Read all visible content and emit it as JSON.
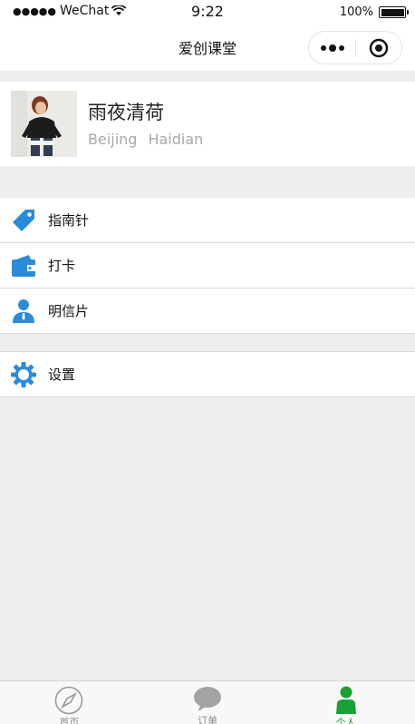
{
  "status_bar": {
    "carrier": "WeChat",
    "time": "9:22",
    "battery": "100%"
  },
  "nav": {
    "title": "爱创课堂"
  },
  "profile": {
    "name": "雨夜清荷",
    "city": "Beijing",
    "district": "Haidian"
  },
  "menu_group1": [
    {
      "label": "指南针",
      "icon": "tag-icon"
    },
    {
      "label": "打卡",
      "icon": "wallet-icon"
    },
    {
      "label": "明信片",
      "icon": "person-icon"
    }
  ],
  "menu_group2": [
    {
      "label": "设置",
      "icon": "gear-icon"
    }
  ],
  "tabbar": [
    {
      "label": "首页",
      "icon": "compass-icon"
    },
    {
      "label": "订单",
      "icon": "chat-bubble-icon"
    },
    {
      "label": "个人",
      "icon": "person-icon",
      "active": true
    }
  ],
  "colors": {
    "accent_blue": "#2a8bd8",
    "active_green": "#1aa035"
  }
}
